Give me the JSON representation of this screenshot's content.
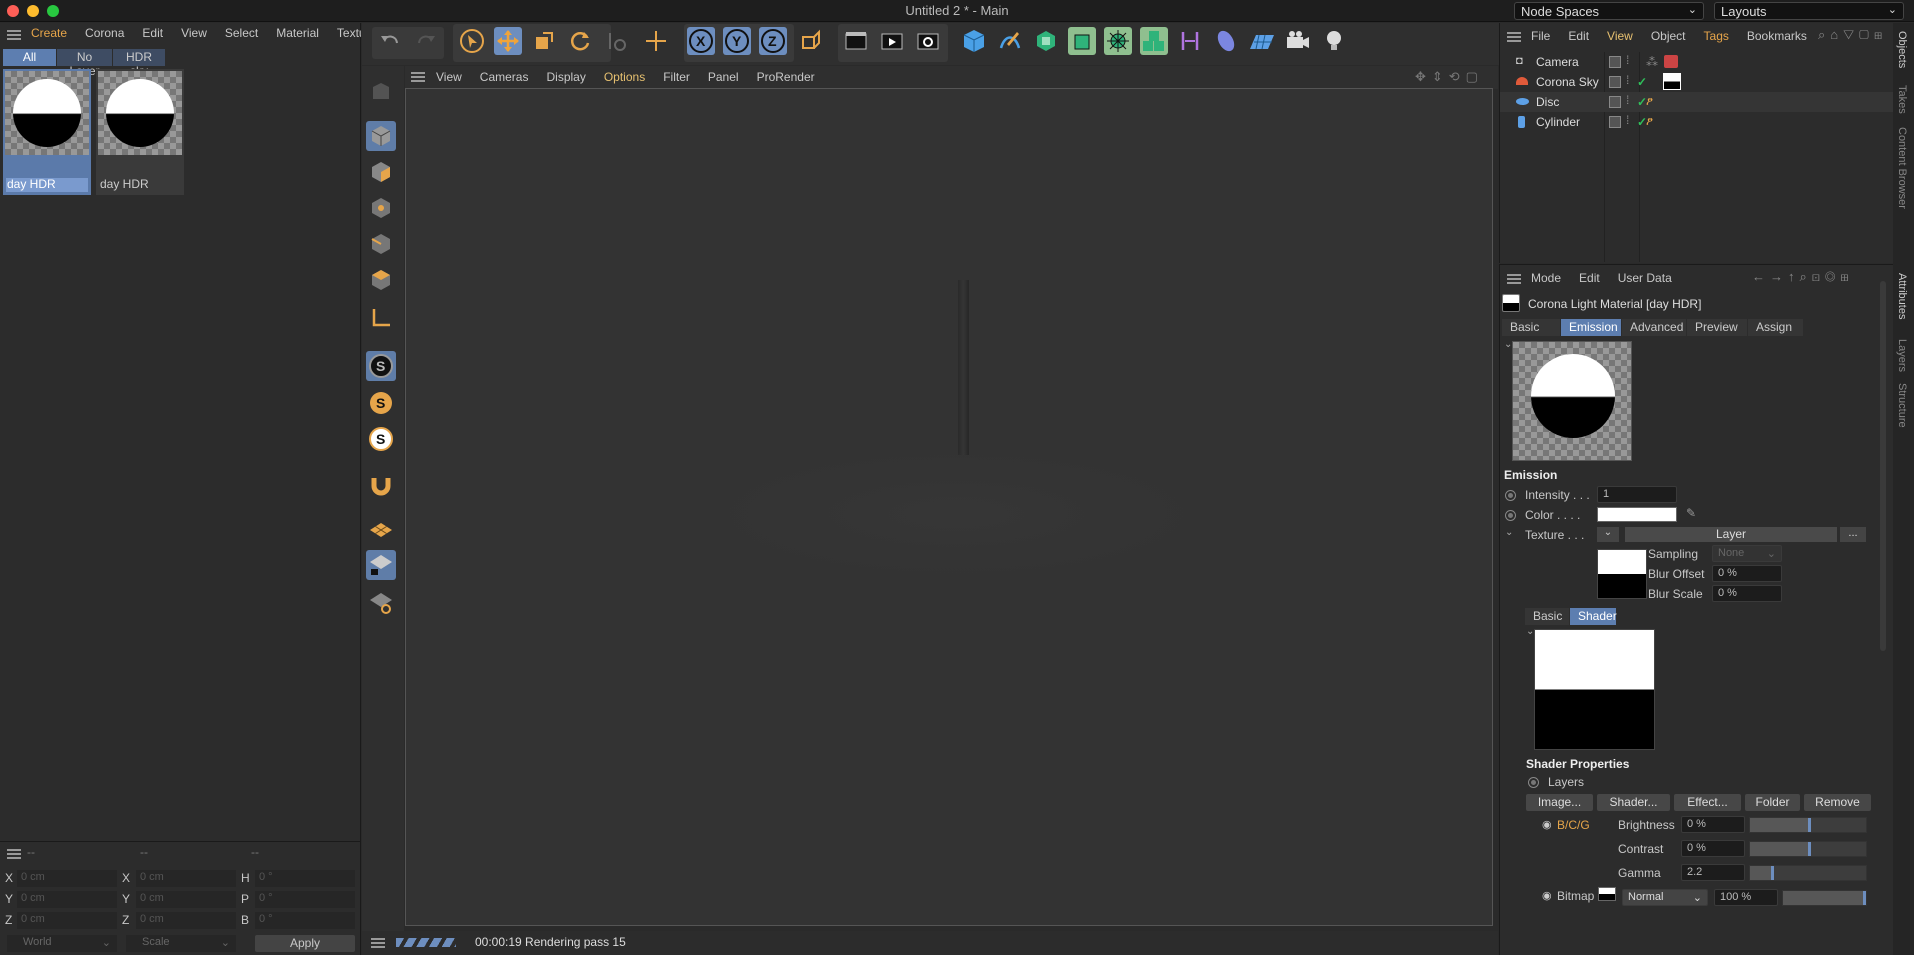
{
  "window": {
    "title": "Untitled 2 * - Main"
  },
  "top_right": {
    "node_spaces": "Node Spaces",
    "layouts": "Layouts"
  },
  "material_manager": {
    "menu": [
      "Create",
      "Corona",
      "Edit",
      "View",
      "Select",
      "Material",
      "Textur"
    ],
    "filters": [
      "All",
      "No Layer",
      "HDR sky"
    ],
    "materials": [
      {
        "name": "day HDR"
      },
      {
        "name": "day HDR"
      }
    ]
  },
  "coords": {
    "headers": [
      "--",
      "--",
      "--"
    ],
    "rows": [
      {
        "a": "X",
        "av": "0 cm",
        "b": "X",
        "bv": "0 cm",
        "c": "H",
        "cv": "0 °"
      },
      {
        "a": "Y",
        "av": "0 cm",
        "b": "Y",
        "bv": "0 cm",
        "c": "P",
        "cv": "0 °"
      },
      {
        "a": "Z",
        "av": "0 cm",
        "b": "Z",
        "bv": "0 cm",
        "c": "B",
        "cv": "0 °"
      }
    ],
    "world": "World",
    "scale": "Scale",
    "apply": "Apply"
  },
  "viewport": {
    "menu": [
      "View",
      "Cameras",
      "Display",
      "Options",
      "Filter",
      "Panel",
      "ProRender"
    ],
    "active_menu": "Options",
    "status": "00:00:19 Rendering pass 15"
  },
  "objects": {
    "menu": [
      "File",
      "Edit",
      "View",
      "Object",
      "Tags",
      "Bookmarks"
    ],
    "items": [
      {
        "name": "Camera",
        "icon": "camera-icon"
      },
      {
        "name": "Corona Sky",
        "icon": "sky-icon"
      },
      {
        "name": "Disc",
        "icon": "disc-icon"
      },
      {
        "name": "Cylinder",
        "icon": "cylinder-icon"
      }
    ]
  },
  "side_tabs": {
    "right_top": [
      "Objects",
      "Takes",
      "Content Browser"
    ],
    "right_bottom": [
      "Attributes",
      "Layers",
      "Structure"
    ]
  },
  "attributes": {
    "menu": [
      "Mode",
      "Edit",
      "User Data"
    ],
    "title": "Corona Light Material [day HDR]",
    "tabs": [
      "Basic",
      "Emission",
      "Advanced",
      "Preview",
      "Assign"
    ],
    "active_tab": "Emission",
    "section": "Emission",
    "intensity_label": "Intensity . . .",
    "intensity": "1",
    "color_label": "Color . . . .",
    "texture_label": "Texture . . .",
    "layer_label": "Layer",
    "more": "...",
    "sampling_label": "Sampling",
    "sampling": "None",
    "blur_offset_label": "Blur Offset",
    "blur_offset": "0 %",
    "blur_scale_label": "Blur Scale",
    "blur_scale": "0 %",
    "shader_tabs": [
      "Basic",
      "Shader"
    ],
    "shader_props": "Shader Properties",
    "layers_label": "Layers",
    "buttons": [
      "Image...",
      "Shader...",
      "Effect...",
      "Folder",
      "Remove"
    ],
    "bcg": "B/C/G",
    "brightness_label": "Brightness",
    "brightness": "0 %",
    "contrast_label": "Contrast",
    "contrast": "0 %",
    "gamma_label": "Gamma",
    "gamma": "2.2",
    "bitmap": "Bitmap",
    "blend": "Normal",
    "opacity": "100 %",
    "accent": "#6d8ebf"
  }
}
